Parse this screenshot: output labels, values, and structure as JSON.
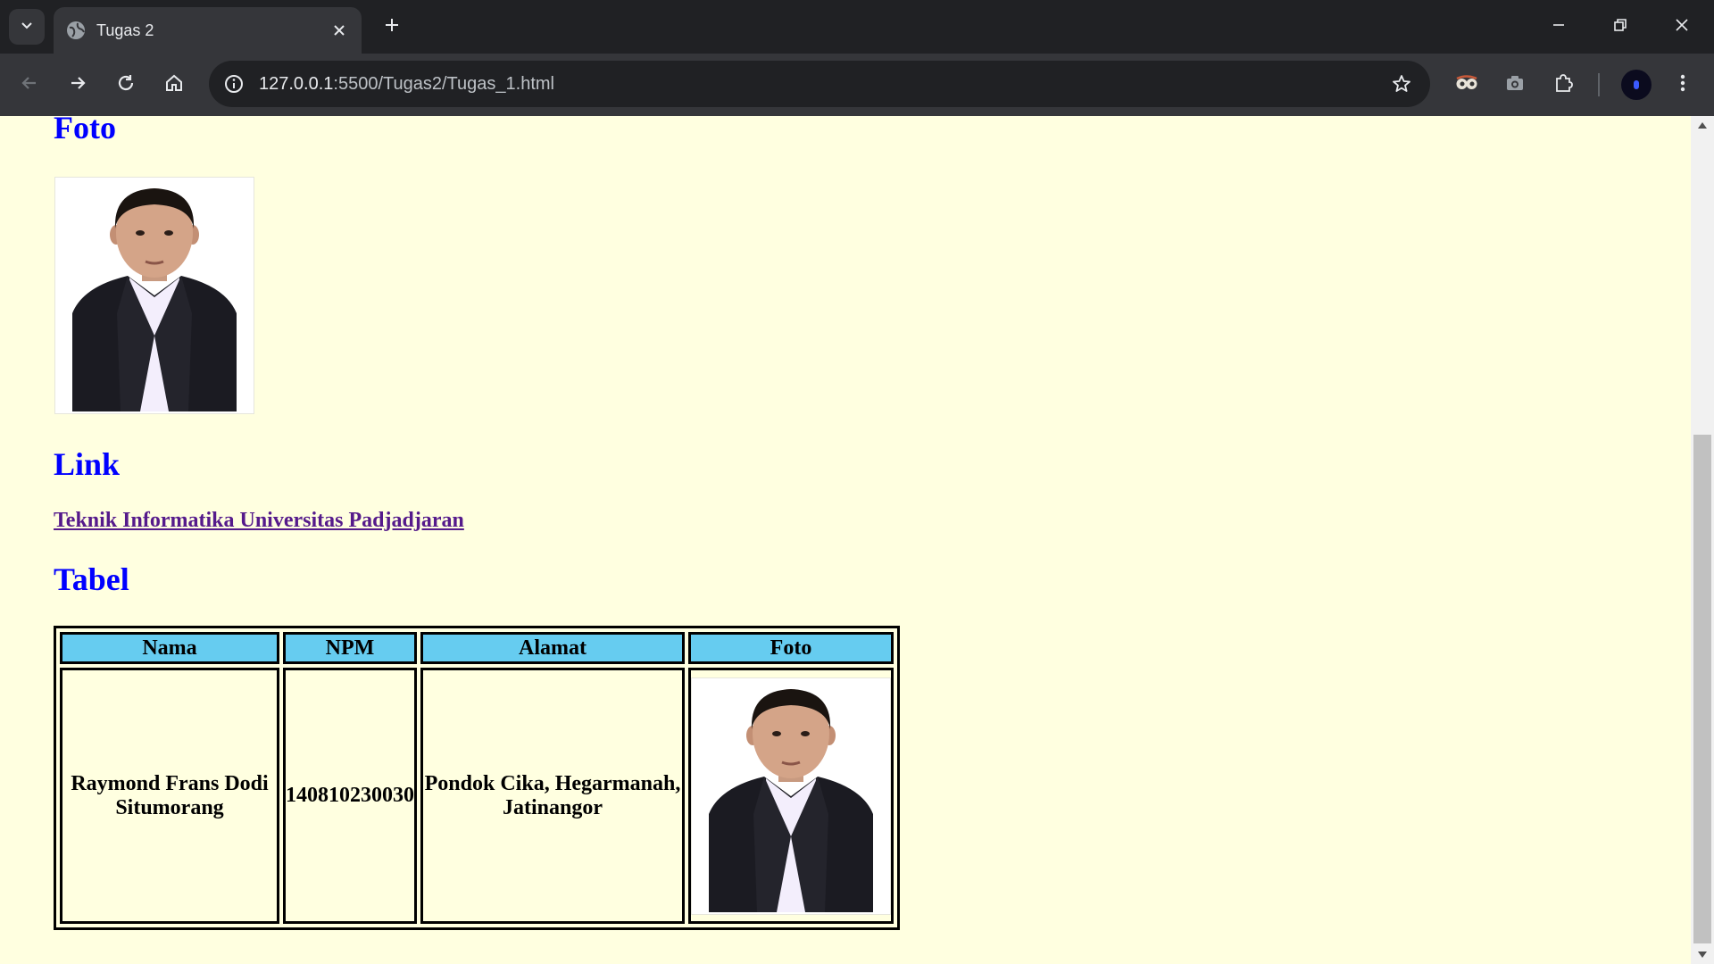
{
  "browser": {
    "tab_title": "Tugas 2",
    "url_host": "127.0.0.1",
    "url_rest": ":5500/Tugas2/Tugas_1.html"
  },
  "page": {
    "foto_heading": "Foto",
    "link_heading": "Link",
    "link_text": "Teknik Informatika Universitas Padjadjaran",
    "tabel_heading": "Tabel",
    "table": {
      "headers": [
        "Nama",
        "NPM",
        "Alamat",
        "Foto"
      ],
      "row": {
        "nama": "Raymond Frans Dodi Situmorang",
        "npm": "140810230030",
        "alamat": "Pondok Cika, Hegarmanah, Jatinangor"
      }
    }
  },
  "colors": {
    "page_background": "#ffffe0",
    "heading": "#0000ff",
    "visited_link": "#551a8b",
    "table_header_bg": "#66ccf0"
  },
  "icons": {
    "tab_search": "chevron-down-icon",
    "tab_close": "close-icon",
    "new_tab": "plus-icon",
    "back": "back-arrow-icon",
    "forward": "forward-arrow-icon",
    "reload": "reload-icon",
    "home": "home-icon",
    "site_info": "info-icon",
    "bookmark": "star-icon"
  }
}
